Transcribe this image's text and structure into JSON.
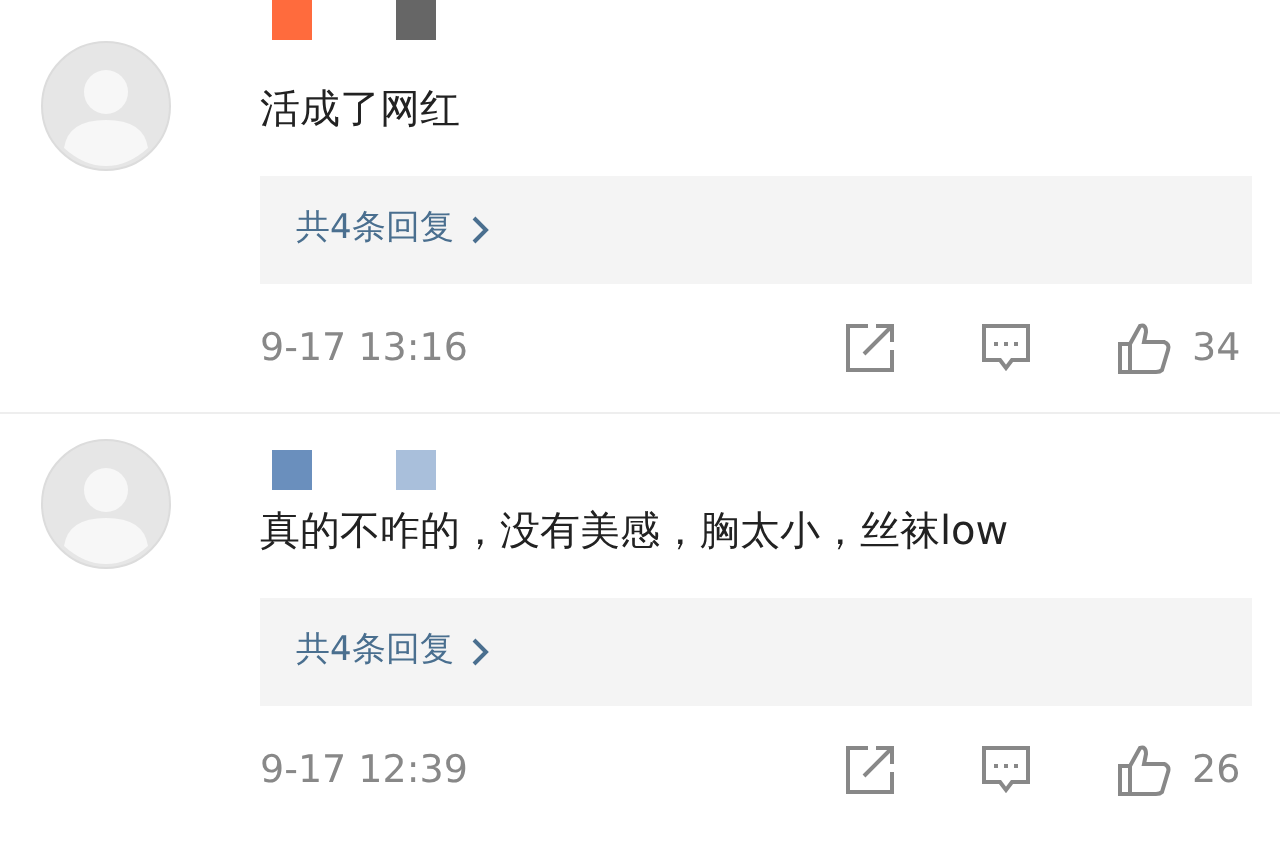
{
  "comments": [
    {
      "name_mask": [
        {
          "color": "#ff6b3d"
        },
        {
          "color": "#666666"
        }
      ],
      "text": "活成了网红",
      "replies": "共4条回复",
      "time": "9-17 13:16",
      "likes": "34"
    },
    {
      "name_mask": [
        {
          "color": "#6a8fbd"
        },
        {
          "color": "#a9bfdb"
        }
      ],
      "text": "真的不咋的，没有美感，胸太小，丝袜low",
      "replies": "共4条回复",
      "time": "9-17 12:39",
      "likes": "26"
    }
  ]
}
